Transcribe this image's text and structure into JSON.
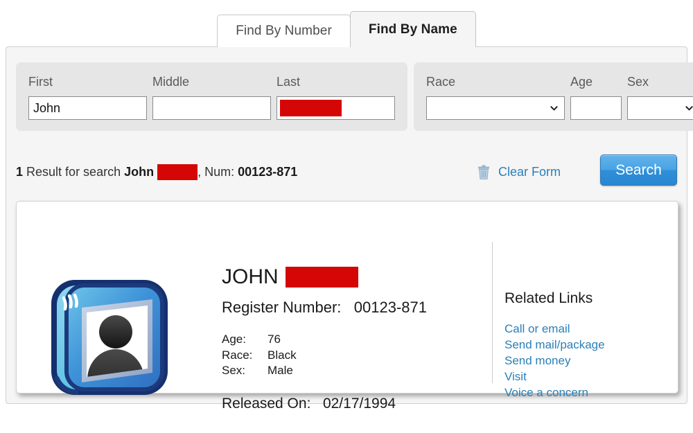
{
  "tabs": [
    {
      "label": "Find By Number",
      "active": false
    },
    {
      "label": "Find By Name",
      "active": true
    }
  ],
  "search_form": {
    "name_group": {
      "first": {
        "label": "First",
        "value": "John",
        "placeholder": ""
      },
      "middle": {
        "label": "Middle",
        "value": "",
        "placeholder": ""
      },
      "last": {
        "label": "Last",
        "value": "",
        "redacted": true,
        "placeholder": ""
      }
    },
    "demo_group": {
      "race": {
        "label": "Race",
        "value": "",
        "options": [
          ""
        ]
      },
      "age": {
        "label": "Age",
        "value": "",
        "placeholder": ""
      },
      "sex": {
        "label": "Sex",
        "value": "",
        "options": [
          ""
        ]
      }
    }
  },
  "summary": {
    "count": "1",
    "prefix": "Result for search",
    "first_name": "John",
    "last_name_redacted": true,
    "separator": ", Num:",
    "register_number": "00123-871"
  },
  "actions": {
    "clear_form_label": "Clear Form",
    "clear_form_icon": "trash-icon",
    "search_label": "Search"
  },
  "result": {
    "avatar_icon": "photo-placeholder-icon",
    "name": "JOHN",
    "name_redacted": true,
    "register_label": "Register Number:",
    "register_number": "00123-871",
    "attributes": [
      {
        "key": "Age:",
        "value": "76"
      },
      {
        "key": "Race:",
        "value": "Black"
      },
      {
        "key": "Sex:",
        "value": "Male"
      }
    ],
    "released_label": "Released On:",
    "released_date": "02/17/1994",
    "related": {
      "title": "Related Links",
      "links": [
        "Call or email",
        "Send mail/package",
        "Send money",
        "Visit",
        "Voice a concern"
      ]
    }
  },
  "colors": {
    "redaction": "#d50606",
    "link": "#2a7fb8",
    "button": "#2e8fd8",
    "panel_bg": "#f5f5f5",
    "field_bg": "#e6e6e6"
  }
}
